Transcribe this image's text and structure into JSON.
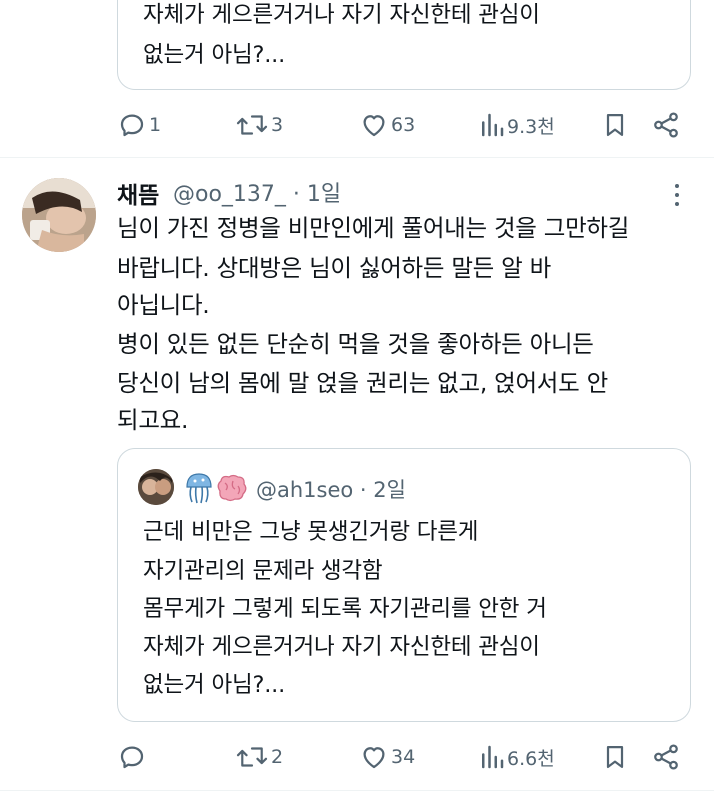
{
  "top_quote": {
    "lines": [
      "자체가 게으른거거나 자기 자신한테 관심이",
      "없는거 아님?..."
    ]
  },
  "top_actions": {
    "reply": "1",
    "retweet": "3",
    "like": "63",
    "views": "9.3천"
  },
  "tweet": {
    "display_name": "채뜸",
    "handle_time": "@oo_137_ · 1일",
    "body_lines": [
      "님이 가진 정병을 비만인에게 풀어내는 것을 그만하길",
      "바랍니다. 상대방은 님이 싫어하든 말든 알 바",
      "아닙니다.",
      "병이 있든 없든 단순히 먹을 것을 좋아하든 아니든",
      "당신이 남의 몸에 말 얹을 권리는 없고, 얹어서도 안",
      "되고요."
    ],
    "quote": {
      "handle_time": "@ah1seo · 2일",
      "lines": [
        "근데 비만은 그냥 못생긴거랑 다른게",
        "자기관리의 문제라 생각함",
        "몸무게가 그렇게 되도록 자기관리를 안한 거",
        "자체가 게으른거거나 자기 자신한테 관심이",
        "없는거 아님?..."
      ]
    },
    "actions": {
      "reply": "",
      "retweet": "2",
      "like": "34",
      "views": "6.6천"
    }
  },
  "colors": {
    "text": "#0f1419",
    "secondary": "#536471",
    "border": "#cfd9de"
  }
}
